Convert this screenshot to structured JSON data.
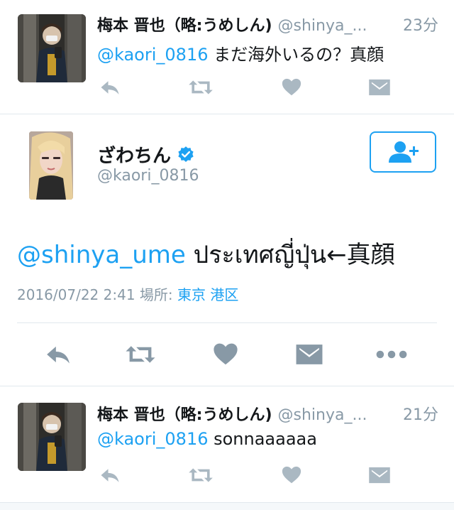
{
  "reply1": {
    "name": "梅本 晋也（略:うめしん)",
    "handle": "@shinya_...",
    "time": "23分",
    "mention": "@kaori_0816",
    "text": " まだ海外いるの？真顔"
  },
  "main_tweet": {
    "name": "ざわちん",
    "handle": "@kaori_0816",
    "mention": "@shinya_ume",
    "text": " ประเทศญี่ปุ่น←真顔",
    "date": "2016/07/22 2:41",
    "location_label": "場所:",
    "location": "東京 港区",
    "verified_color": "#1da1f2"
  },
  "reply2": {
    "name": "梅本 晋也（略:うめしん)",
    "handle": "@shinya_...",
    "time": "21分",
    "mention": "@kaori_0816",
    "text": " sonnaaaaaa"
  },
  "icons": {
    "reply": "reply-icon",
    "retweet": "retweet-icon",
    "like": "heart-icon",
    "dm": "envelope-icon",
    "more": "more-dots-icon",
    "follow": "add-user-icon"
  },
  "colors": {
    "accent": "#1da1f2",
    "secondary_text": "#8899a6",
    "icon_light": "#aab8c2"
  }
}
